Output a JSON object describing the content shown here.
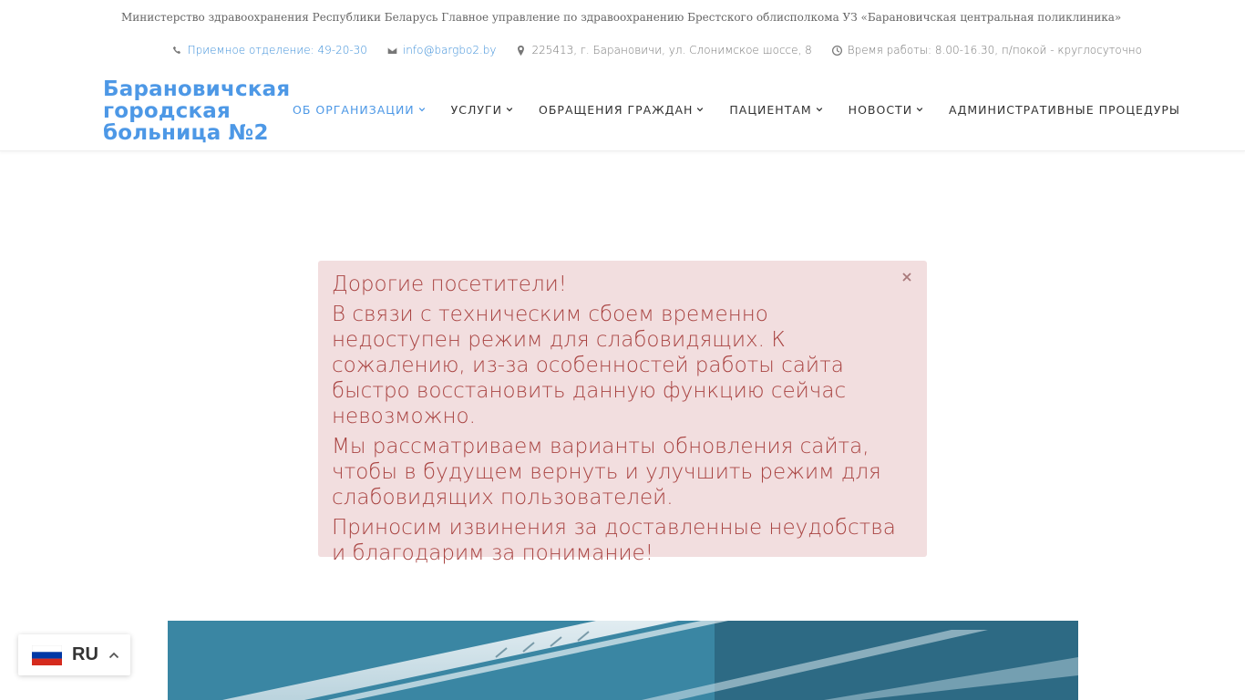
{
  "topbar": {
    "ministry_text": "Министерство здравоохранения Республики Беларусь Главное управление по здравоохранению Брестского облисполкома УЗ «Барановичская центральная поликлиника»",
    "phone": {
      "icon": "phone-icon",
      "label": "Приемное отделение: 49-20-30"
    },
    "email": {
      "icon": "envelope-icon",
      "label": "info@bargbo2.by"
    },
    "address": {
      "icon": "map-marker-icon",
      "label": "225413, г. Барановичи, ул. Слонимское шоссе, 8"
    },
    "hours": {
      "icon": "clock-icon",
      "label": "Время работы: 8.00-16.30, п/покой - круглосуточно"
    }
  },
  "header": {
    "logo_lines": [
      "Барановичская",
      "городская",
      "больница №2"
    ],
    "nav": [
      {
        "label": "ОБ ОРГАНИЗАЦИИ",
        "active": true,
        "dropdown": true
      },
      {
        "label": "УСЛУГИ",
        "active": false,
        "dropdown": true
      },
      {
        "label": "ОБРАЩЕНИЯ ГРАЖДАН",
        "active": false,
        "dropdown": true
      },
      {
        "label": "ПАЦИЕНТАМ",
        "active": false,
        "dropdown": true
      },
      {
        "label": "НОВОСТИ",
        "active": false,
        "dropdown": true
      },
      {
        "label": "АДМИНИСТРАТИВНЫЕ ПРОЦЕДУРЫ",
        "active": false,
        "dropdown": false
      }
    ]
  },
  "alert": {
    "paragraphs": [
      "Дорогие посетители!",
      "В связи с техническим сбоем временно недоступен режим для слабовидящих. К сожалению, из-за особенностей работы сайта быстро восстановить данную функцию сейчас невозможно.",
      "Мы рассматриваем варианты обновления сайта, чтобы в будущем вернуть и улучшить режим для слабовидящих пользователей.",
      "Приносим извинения за доставленные неудобства и благодарим за понимание!"
    ],
    "close_icon": "close-icon"
  },
  "language": {
    "code": "RU",
    "flag_icon": "russia-flag-icon",
    "toggle_icon": "chevron-up-icon"
  },
  "colors": {
    "accent": "#4d98e6",
    "link": "#3d8fd9",
    "alert_bg": "#f2dedf",
    "alert_text": "#a94442"
  }
}
